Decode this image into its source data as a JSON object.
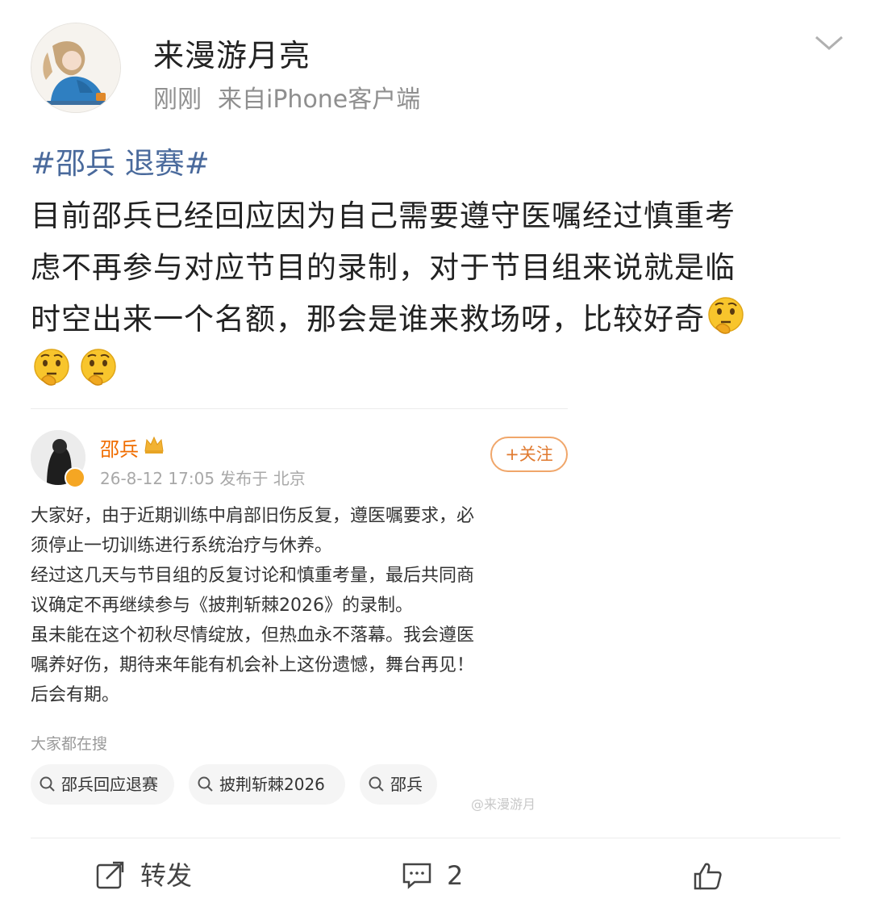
{
  "post": {
    "username": "来漫游月亮",
    "time": "刚刚",
    "source": "来自iPhone客户端",
    "hashtag": "#邵兵 退赛#",
    "text": "目前邵兵已经回应因为自己需要遵守医嘱经过慎重考虑不再参与对应节目的录制，对于节目组来说就是临时空出来一个名额，那会是谁来救场呀，比较好奇",
    "text_lines": [
      "目前邵兵已经回应因为自己需要遵守医嘱经过慎重考",
      "虑不再参与对应节目的录制，对于节目组来说就是临",
      "时空出来一个名额，那会是谁来救场呀，比较好奇"
    ],
    "emoji": "thinking-face-emoji"
  },
  "embedded": {
    "name": "邵兵",
    "time": "26-8-12 17:05",
    "location": "发布于 北京",
    "follow_label": "+关注",
    "lines": [
      "大家好，由于近期训练中肩部旧伤反复，遵医嘱要求，必",
      "须停止一切训练进行系统治疗与休养。",
      "经过这几天与节目组的反复讨论和慎重考量，最后共同商",
      "议确定不再继续参与《披荆斩棘2026》的录制。",
      "虽未能在这个初秋尽情绽放，但热血永不落幕。我会遵医",
      "嘱养好伤，期待来年能有机会补上这份遗憾，舞台再见！",
      "后会有期。"
    ],
    "search_label": "大家都在搜",
    "chips": [
      "邵兵回应退赛",
      "披荆斩棘2026",
      "邵兵"
    ],
    "watermark": "@来漫游月"
  },
  "actions": {
    "repost_label": "转发",
    "comment_count": "2"
  },
  "colors": {
    "hashtag": "#4a6a9c",
    "embedded_name": "#f06d00",
    "follow": "#e07a2f"
  }
}
